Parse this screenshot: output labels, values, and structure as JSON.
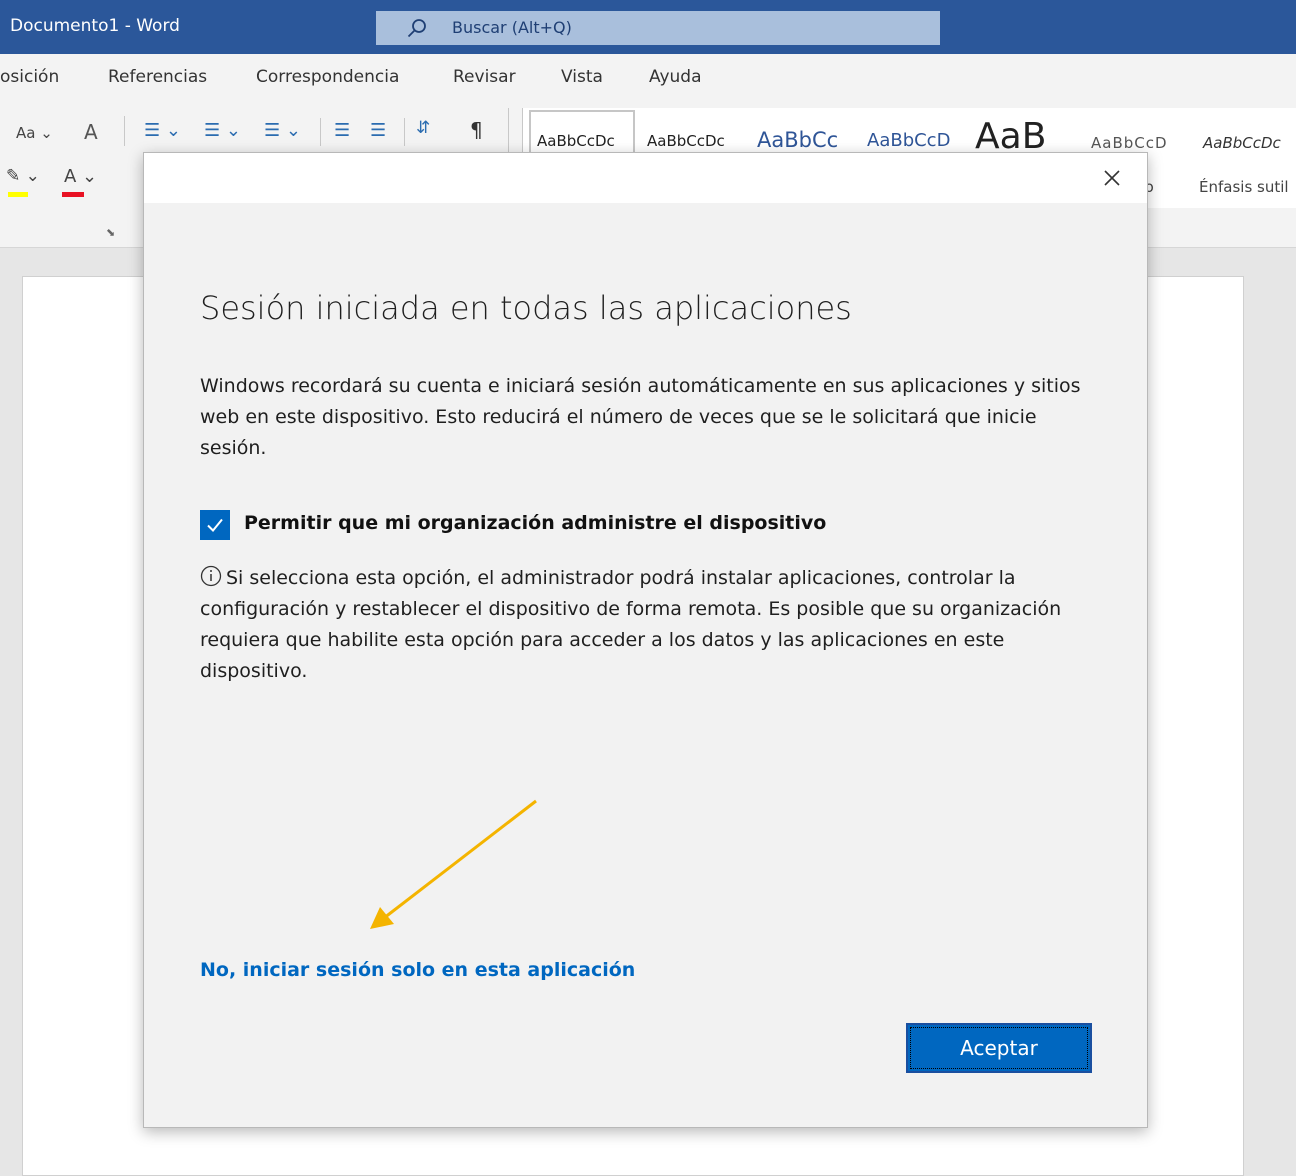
{
  "window": {
    "title": "Documento1  -  Word",
    "search_placeholder": "Buscar (Alt+Q)"
  },
  "menu": {
    "items": [
      "osición",
      "Referencias",
      "Correspondencia",
      "Revisar",
      "Vista",
      "Ayuda"
    ]
  },
  "ribbon": {
    "font_case": "Aa",
    "highlight_color": "#ffff00",
    "font_color": "#e81123",
    "paragraph_mark": "¶",
    "styles_samples": [
      "AaBbCcDc",
      "AaBbCcDc",
      "AaBbCc",
      "AaBbCcD",
      "AaB",
      "AaBbCcD",
      "AaBbCcDc"
    ],
    "styles_names": [
      "ulo",
      "Énfasis sutil"
    ]
  },
  "dialog": {
    "title": "Sesión iniciada en todas las aplicaciones",
    "description": "Windows recordará su cuenta e iniciará sesión automáticamente en sus aplicaciones y sitios web en este dispositivo. Esto reducirá el número de veces que se le solicitará que inicie sesión.",
    "checkbox": {
      "checked": true,
      "label": "Permitir que mi organización administre el dispositivo"
    },
    "info": "Si selecciona esta opción, el administrador podrá instalar aplicaciones, controlar la configuración y restablecer el dispositivo de forma remota. Es posible que su organización requiera que habilite esta opción para acceder a los datos y las aplicaciones en este dispositivo.",
    "link": "No, iniciar sesión solo en esta aplicación",
    "accept_button": "Aceptar"
  },
  "colors": {
    "word_blue": "#2b579a",
    "accent": "#0067c0",
    "annotation_arrow": "#f4b400"
  },
  "icons": [
    "search-icon",
    "close-icon",
    "checkmark-icon",
    "info-icon",
    "arrow-annotation"
  ]
}
